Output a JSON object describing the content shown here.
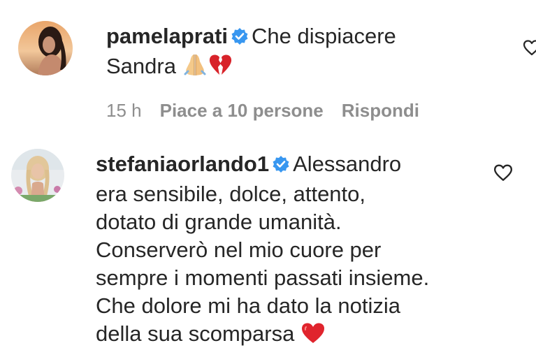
{
  "comments": [
    {
      "username": "pamelaprati",
      "verified": true,
      "avatar": "avatar-pamelaprati",
      "text_line1": "Che dispiacere",
      "text_line2": "Sandra",
      "emojis": [
        "folded-hands-icon",
        "broken-heart-icon"
      ],
      "time": "15 h",
      "likes": "Piace a 10 persone",
      "reply": "Rispondi",
      "like_icon": "heart-outline-icon"
    },
    {
      "username": "stefaniaorlando1",
      "verified": true,
      "avatar": "avatar-stefaniaorlando1",
      "text_line1": "Alessandro",
      "lines": [
        "era sensibile, dolce, attento,",
        "dotato di grande umanità.",
        "Conserverò nel mio cuore per",
        "sempre i momenti passati insieme.",
        "Che dolore mi ha dato la notizia",
        "della sua scomparsa"
      ],
      "emojis": [
        "red-heart-icon"
      ],
      "like_icon": "heart-outline-icon"
    }
  ],
  "colors": {
    "text": "#262626",
    "meta": "#8e8e8e",
    "verified": "#3897f0",
    "heart_red": "#e0242d"
  }
}
